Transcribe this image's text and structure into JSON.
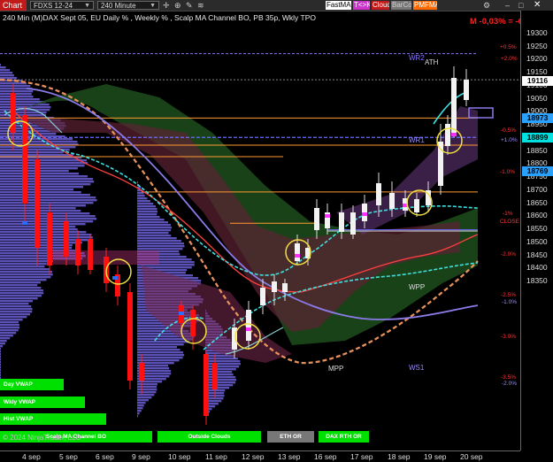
{
  "toolbar": {
    "chart_tab": "Chart",
    "instrument": "FDXS 12-24",
    "period": "240 Minute",
    "buttons": [
      {
        "label": "FastMA",
        "color": "#ffffff",
        "text": "#000000"
      },
      {
        "label": "T<>K",
        "color": "#cc33cc",
        "text": "#ffffff"
      },
      {
        "label": "Cloud",
        "color": "#c01a1a",
        "text": "#ffffff"
      },
      {
        "label": "BarCol",
        "color": "#777777",
        "text": "#cfcfcf"
      },
      {
        "label": "PMFMA",
        "color": "#ff6a00",
        "text": "#ffffff"
      }
    ]
  },
  "title": "240 Min (M)DAX Sept 05, EU Daily % , Weekly % , Scalp MA Channel BO, PB 35p, Wkly TPO",
  "m_label": "M -0,03% = -6",
  "price_axis": {
    "ticks": [
      "19300",
      "19250",
      "19200",
      "19150",
      "19100",
      "19050",
      "19000",
      "18950",
      "18900",
      "18850",
      "18800",
      "18750",
      "18700",
      "18650",
      "18600",
      "18550",
      "18500",
      "18450",
      "18400",
      "18350"
    ],
    "current_price": "19116",
    "markers": [
      {
        "text": "18973",
        "bg": "#2aa0ff",
        "fg": "#000000"
      },
      {
        "text": "18899",
        "bg": "#00e0e0",
        "fg": "#000000"
      },
      {
        "text": "18769",
        "bg": "#2aa0ff",
        "fg": "#000000"
      }
    ]
  },
  "pct_labels": {
    "daily": [
      "+2.0%",
      "-1.0%",
      "-2.0%",
      "-3.0%",
      "-3.5%"
    ],
    "daily_extra": [
      "+0.5%",
      "-0.5%",
      "-1%",
      "-2.5%",
      "CLOSE"
    ],
    "weekly": [
      "+1.0%",
      "-1.0%",
      "-2.0%"
    ]
  },
  "levels": {
    "wr2": "WR2",
    "wr1": "WR1",
    "wpp": "WPP",
    "ws1": "WS1",
    "mpp": "MPP",
    "ath": "ATH"
  },
  "dates": [
    "4 sep",
    "5 sep",
    "6 sep",
    "9 sep",
    "10 sep",
    "11 sep",
    "12 sep",
    "13 sep",
    "16 sep",
    "17 sep",
    "18 sep",
    "19 sep",
    "20 sep"
  ],
  "green_buttons": [
    "Day VWAP",
    "Wkly VWAP",
    "Hist VWAP"
  ],
  "bottom_buttons": [
    {
      "label": "Scalp MA Channel BO",
      "bg": "#00e000"
    },
    {
      "label": "Outside Clouds",
      "bg": "#00e000"
    },
    {
      "label": "ETH OR",
      "bg": "#777777"
    },
    {
      "label": "DAX RTH OR",
      "bg": "#00e000"
    }
  ],
  "copyright": "© 2024 NinjaTrader, LLC"
}
